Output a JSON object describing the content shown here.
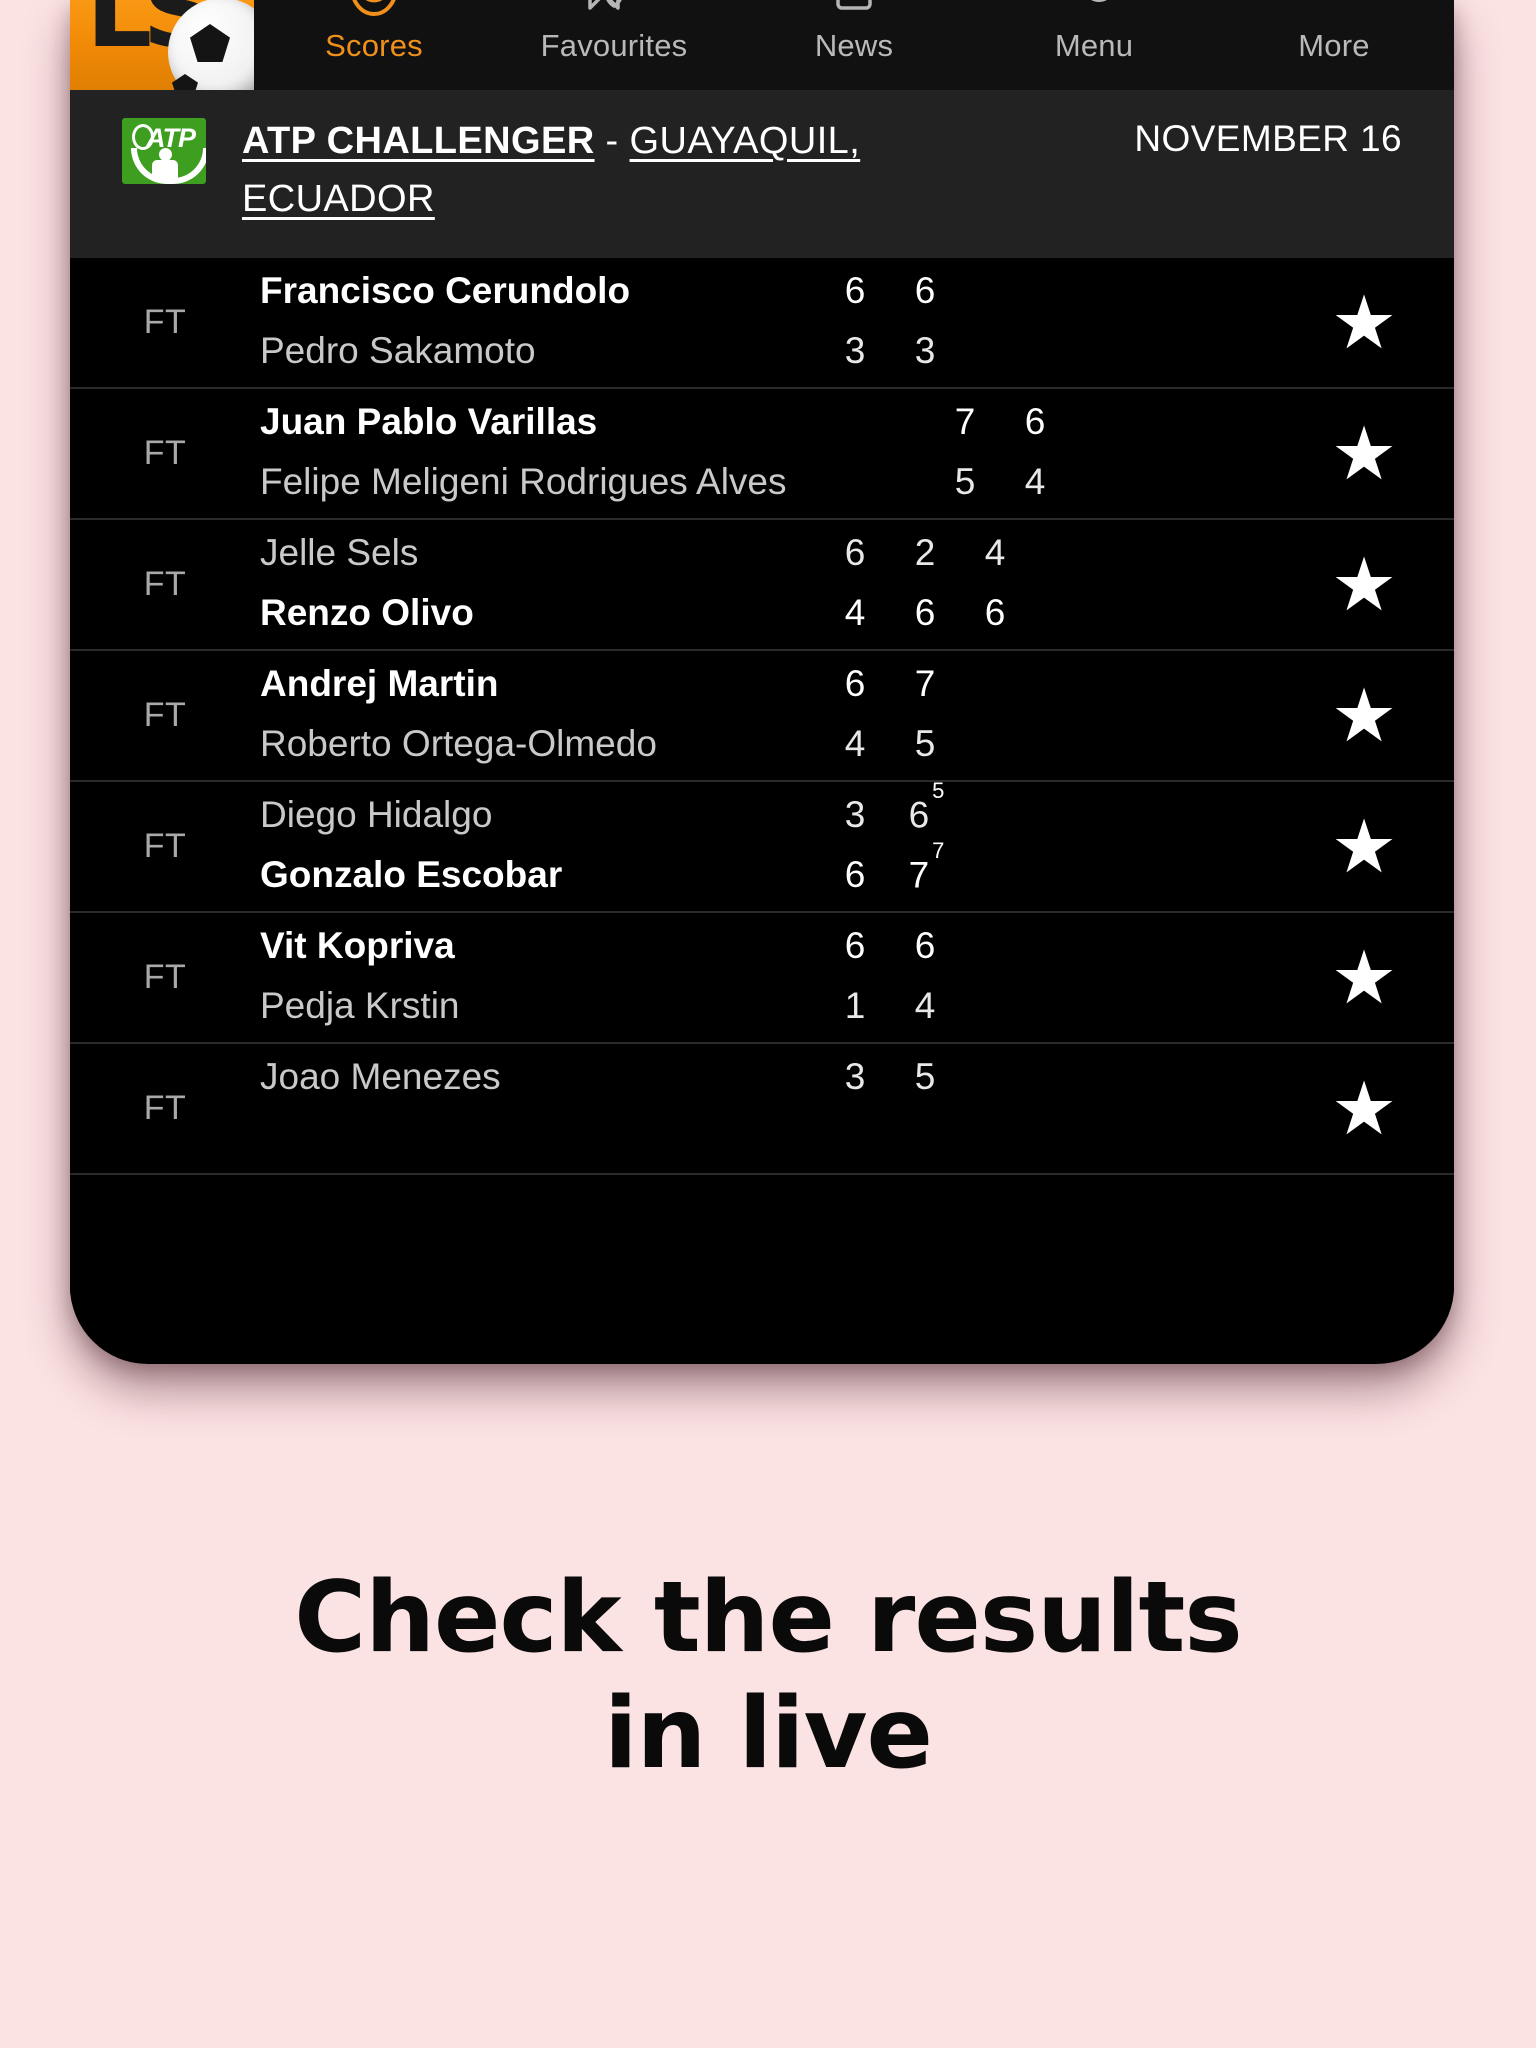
{
  "app": {
    "logo_text": "LS",
    "logo_icon": "livescore-logo-soccer-ball"
  },
  "nav": {
    "items": [
      {
        "label": "Scores",
        "icon": "scores-shield-icon",
        "active": true
      },
      {
        "label": "Favourites",
        "icon": "star-bookmark-icon",
        "active": false
      },
      {
        "label": "News",
        "icon": "news-document-icon",
        "active": false
      },
      {
        "label": "Menu",
        "icon": "menu-circles-icon",
        "active": false
      },
      {
        "label": "More",
        "icon": "more-icon",
        "active": false
      }
    ]
  },
  "league": {
    "logo_icon": "atp-logo-icon",
    "logo_text": "ATP",
    "name": "ATP CHALLENGER",
    "separator": " - ",
    "location": "GUAYAQUIL, ECUADOR",
    "date": "NOVEMBER 16"
  },
  "matches": [
    {
      "status": "FT",
      "favourite_icon": "star-icon",
      "indent": false,
      "players": [
        {
          "name": "Francisco Cerundolo",
          "winner": true,
          "sets": [
            {
              "score": "6"
            },
            {
              "score": "6"
            }
          ]
        },
        {
          "name": "Pedro Sakamoto",
          "winner": false,
          "sets": [
            {
              "score": "3"
            },
            {
              "score": "3"
            }
          ]
        }
      ]
    },
    {
      "status": "FT",
      "favourite_icon": "star-icon",
      "indent": true,
      "players": [
        {
          "name": "Juan Pablo Varillas",
          "winner": true,
          "sets": [
            {
              "score": "7"
            },
            {
              "score": "6"
            }
          ]
        },
        {
          "name": "Felipe Meligeni Rodrigues Alves",
          "winner": false,
          "sets": [
            {
              "score": "5"
            },
            {
              "score": "4"
            }
          ]
        }
      ]
    },
    {
      "status": "FT",
      "favourite_icon": "star-icon",
      "indent": false,
      "players": [
        {
          "name": "Jelle Sels",
          "winner": false,
          "sets": [
            {
              "score": "6"
            },
            {
              "score": "2"
            },
            {
              "score": "4"
            }
          ]
        },
        {
          "name": "Renzo Olivo",
          "winner": true,
          "sets": [
            {
              "score": "4"
            },
            {
              "score": "6"
            },
            {
              "score": "6"
            }
          ]
        }
      ]
    },
    {
      "status": "FT",
      "favourite_icon": "star-icon",
      "indent": false,
      "players": [
        {
          "name": "Andrej Martin",
          "winner": true,
          "sets": [
            {
              "score": "6"
            },
            {
              "score": "7"
            }
          ]
        },
        {
          "name": "Roberto Ortega-Olmedo",
          "winner": false,
          "sets": [
            {
              "score": "4"
            },
            {
              "score": "5"
            }
          ]
        }
      ]
    },
    {
      "status": "FT",
      "favourite_icon": "star-icon",
      "indent": false,
      "players": [
        {
          "name": "Diego Hidalgo",
          "winner": false,
          "sets": [
            {
              "score": "3"
            },
            {
              "score": "6",
              "tiebreak": "5"
            }
          ]
        },
        {
          "name": "Gonzalo Escobar",
          "winner": true,
          "sets": [
            {
              "score": "6"
            },
            {
              "score": "7",
              "tiebreak": "7"
            }
          ]
        }
      ]
    },
    {
      "status": "FT",
      "favourite_icon": "star-icon",
      "indent": false,
      "players": [
        {
          "name": "Vit Kopriva",
          "winner": true,
          "sets": [
            {
              "score": "6"
            },
            {
              "score": "6"
            }
          ]
        },
        {
          "name": "Pedja Krstin",
          "winner": false,
          "sets": [
            {
              "score": "1"
            },
            {
              "score": "4"
            }
          ]
        }
      ]
    },
    {
      "status": "FT",
      "favourite_icon": "star-icon",
      "indent": false,
      "players": [
        {
          "name": "Joao Menezes",
          "winner": false,
          "sets": [
            {
              "score": "3"
            },
            {
              "score": "5"
            }
          ]
        },
        {
          "name": "",
          "winner": false,
          "sets": [
            {
              "score": ""
            },
            {
              "score": ""
            }
          ]
        }
      ]
    }
  ],
  "caption": {
    "line1": "Check the results",
    "line2": "in live"
  },
  "colors": {
    "background": "#fce3e3",
    "screen": "#000000",
    "nav_bar": "#111111",
    "league_header": "#222222",
    "accent_orange": "#f0901b",
    "atp_green": "#3d9e1f",
    "text_primary": "#ffffff",
    "text_secondary": "#c9c9c9",
    "divider": "#2a2a2a"
  }
}
